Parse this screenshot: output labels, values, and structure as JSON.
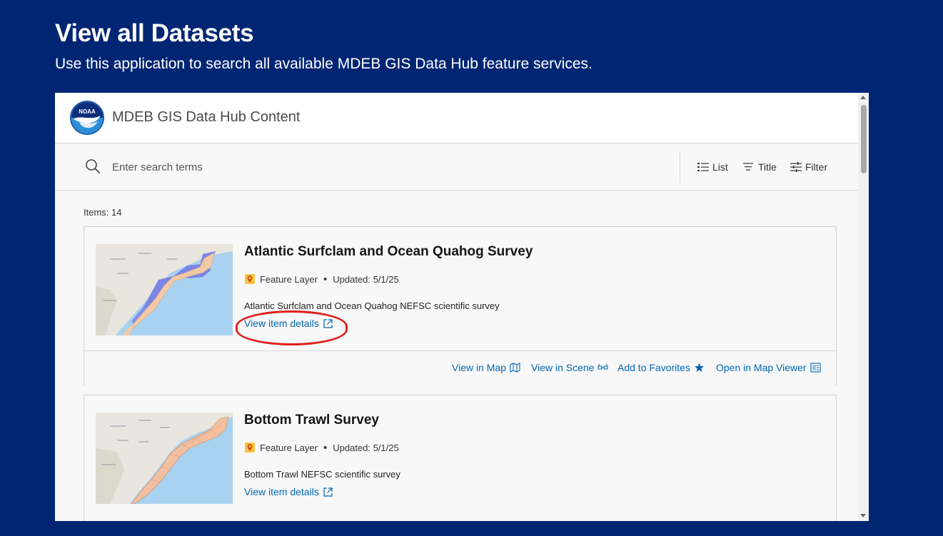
{
  "page": {
    "title": "View all Datasets",
    "subtitle": "Use this application to search all available MDEB GIS Data Hub feature services."
  },
  "app": {
    "title": "MDEB GIS Data Hub Content",
    "logo_text": "NOAA",
    "search": {
      "placeholder": "Enter search terms",
      "value": ""
    },
    "toolbar": {
      "list_label": "List",
      "title_label": "Title",
      "filter_label": "Filter"
    },
    "items_count": "Items: 14",
    "colors": {
      "background": "#002673",
      "link": "#0066b3",
      "highlight": "#e0201b"
    }
  },
  "items": [
    {
      "title": "Atlantic Surfclam and Ocean Quahog Survey",
      "type": "Feature Layer",
      "separator": "•",
      "updated": "Updated: 5/1/25",
      "description": "Atlantic Surfclam and Ocean Quahog NEFSC scientific survey",
      "details_label": "View item details",
      "actions": {
        "view_map": "View in Map",
        "view_scene": "View in Scene",
        "add_favorites": "Add to Favorites",
        "open_viewer": "Open in Map Viewer"
      }
    },
    {
      "title": "Bottom Trawl Survey",
      "type": "Feature Layer",
      "separator": "•",
      "updated": "Updated: 5/1/25",
      "description": "Bottom Trawl NEFSC scientific survey",
      "details_label": "View item details"
    }
  ]
}
